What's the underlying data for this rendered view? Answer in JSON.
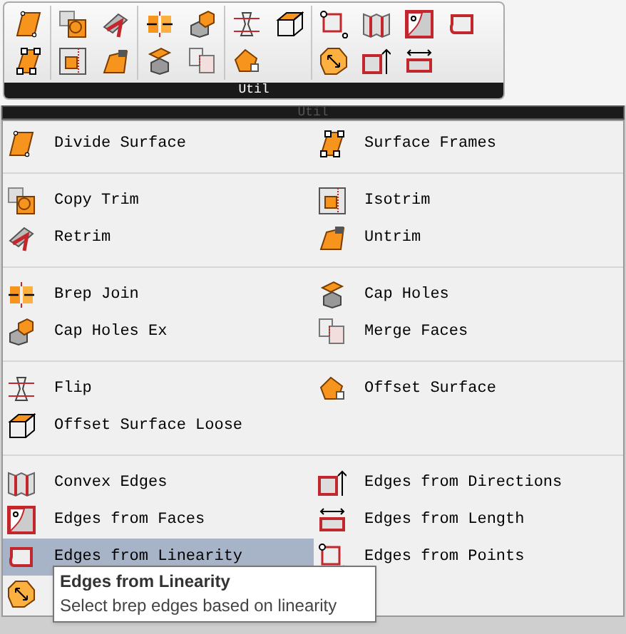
{
  "toolbar": {
    "title": "Util"
  },
  "menu": {
    "title": "Util",
    "groups": [
      {
        "rows": [
          [
            {
              "label": "Divide Surface",
              "selected": false
            },
            {
              "label": "Surface Frames",
              "selected": false
            }
          ]
        ]
      },
      {
        "rows": [
          [
            {
              "label": "Copy Trim",
              "selected": false
            },
            {
              "label": "Isotrim",
              "selected": false
            }
          ],
          [
            {
              "label": "Retrim",
              "selected": false
            },
            {
              "label": "Untrim",
              "selected": false
            }
          ]
        ]
      },
      {
        "rows": [
          [
            {
              "label": "Brep Join",
              "selected": false
            },
            {
              "label": "Cap Holes",
              "selected": false
            }
          ],
          [
            {
              "label": "Cap Holes Ex",
              "selected": false
            },
            {
              "label": "Merge Faces",
              "selected": false
            }
          ]
        ]
      },
      {
        "rows": [
          [
            {
              "label": "Flip",
              "selected": false
            },
            {
              "label": "Offset Surface",
              "selected": false
            }
          ],
          [
            {
              "label": "Offset Surface Loose",
              "selected": false
            }
          ]
        ]
      },
      {
        "rows": [
          [
            {
              "label": "Convex Edges",
              "selected": false
            },
            {
              "label": "Edges from Directions",
              "selected": false
            }
          ],
          [
            {
              "label": "Edges from Faces",
              "selected": false
            },
            {
              "label": "Edges from Length",
              "selected": false
            }
          ],
          [
            {
              "label": "Edges from Linearity",
              "selected": true
            },
            {
              "label": "Edges from Points",
              "selected": false
            }
          ],
          [
            {
              "selected": false
            }
          ]
        ]
      }
    ]
  },
  "tooltip": {
    "title": "Edges from Linearity",
    "text": "Select brep edges based on linearity"
  }
}
